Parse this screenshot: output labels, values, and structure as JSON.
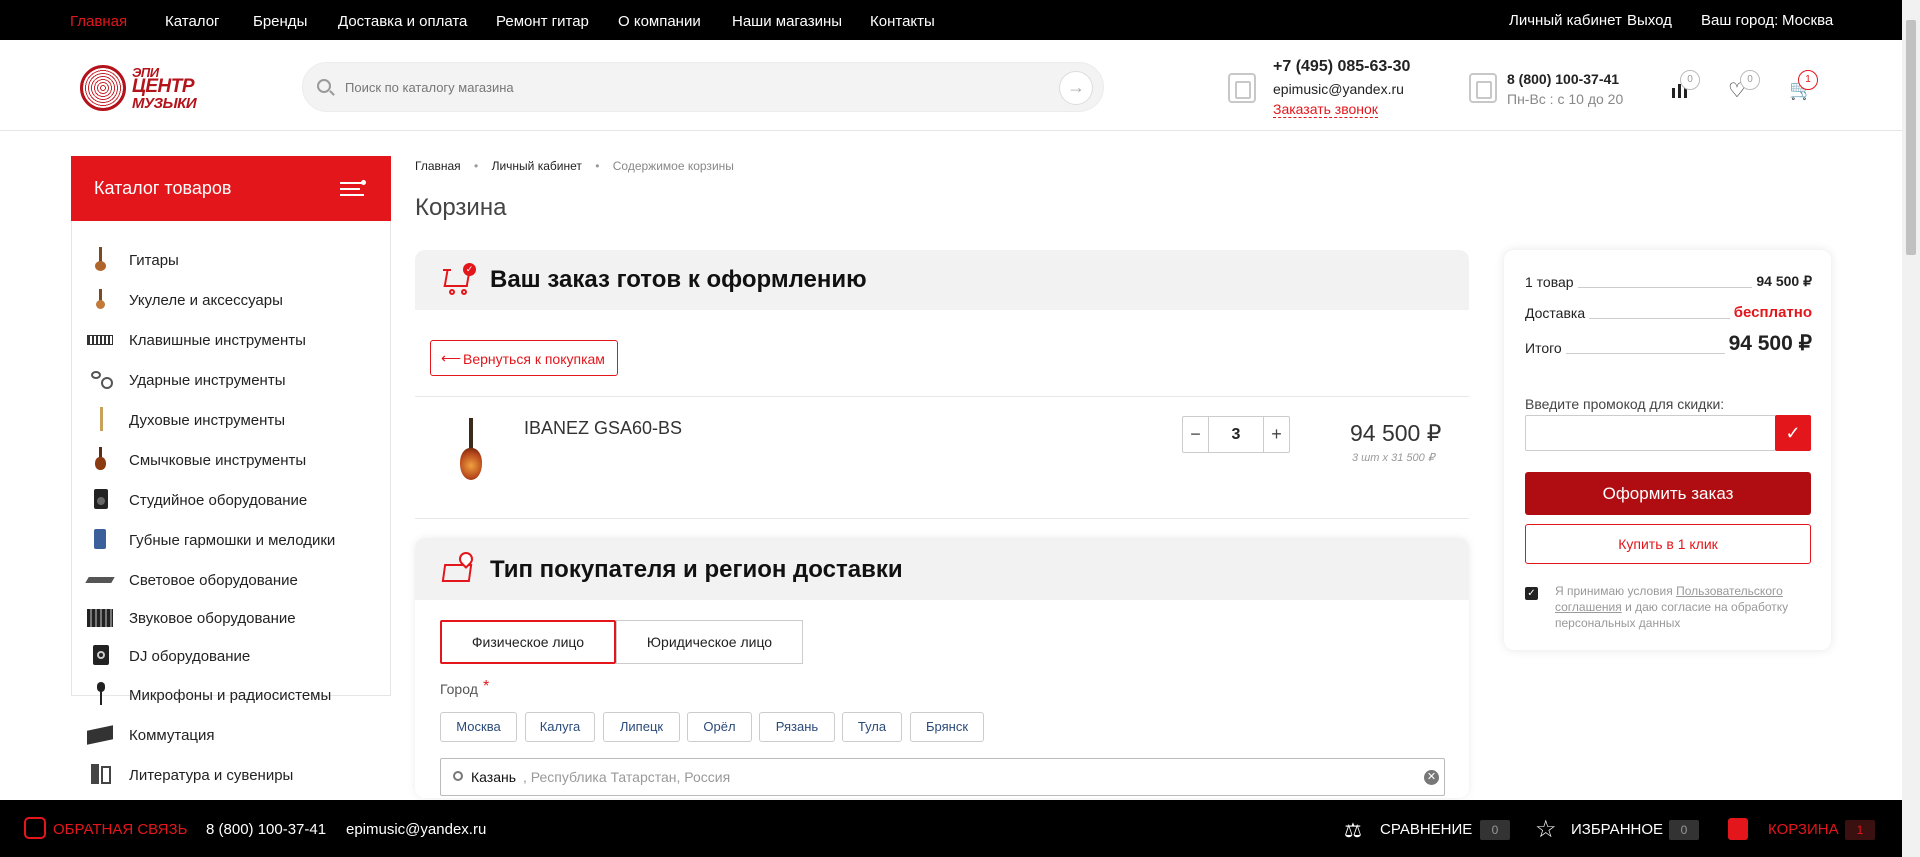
{
  "topnav": {
    "items": [
      "Главная",
      "Каталог",
      "Бренды",
      "Доставка и оплата",
      "Ремонт гитар",
      "О компании",
      "Наши магазины",
      "Контакты"
    ]
  },
  "topright": {
    "account": "Личный кабинет",
    "logout": "Выход",
    "city_label": "Ваш город:",
    "city": "Москва"
  },
  "logo": {
    "line1": "ЭПИ",
    "line2": "ЦЕНТР",
    "line3": "МУЗЫКИ"
  },
  "search": {
    "placeholder": "Поиск по каталогу магазина"
  },
  "contacts": {
    "phone1": "+7 (495) 085-63-30",
    "email": "epimusic@yandex.ru",
    "callback": "Заказать звонок",
    "phone2": "8 (800) 100-37-41",
    "hours": "Пн-Вс : с 10 до 20"
  },
  "header_counts": {
    "compare": "0",
    "favorites": "0",
    "cart": "1"
  },
  "catalog": {
    "title": "Каталог товаров",
    "items": [
      "Гитары",
      "Укулеле и аксессуары",
      "Клавишные инструменты",
      "Ударные инструменты",
      "Духовые инструменты",
      "Смычковые инструменты",
      "Студийное оборудование",
      "Губные гармошки и мелодики",
      "Световое оборудование",
      "Звуковое оборудование",
      "DJ оборудование",
      "Микрофоны и радиосистемы",
      "Коммутация",
      "Литература и сувениры"
    ]
  },
  "breadcrumb": [
    "Главная",
    "Личный кабинет",
    "Содержимое корзины"
  ],
  "page_title": "Корзина",
  "order_ready": {
    "title": "Ваш заказ готов к оформлению",
    "back": "Вернуться к покупкам"
  },
  "cart_item": {
    "name": "IBANEZ GSA60-BS",
    "qty": "3",
    "price": "94 500 ₽",
    "unit_note": "3 шт x 31 500 ₽",
    "minus": "−",
    "plus": "+"
  },
  "buyer": {
    "title": "Тип покупателя и регион доставки",
    "tabs": [
      "Физическое лицо",
      "Юридическое лицо"
    ],
    "city_label": "Город",
    "required_mark": "*",
    "cities": [
      "Москва",
      "Калуга",
      "Липецк",
      "Орёл",
      "Рязань",
      "Тула",
      "Брянск"
    ],
    "city_value": "Казань",
    "city_region": ", Республика Татарстан, Россия"
  },
  "summary": {
    "items_label": "1 товар",
    "items_value": "94 500 ₽",
    "delivery_label": "Доставка",
    "delivery_value": "бесплатно",
    "total_label": "Итого",
    "total_value": "94 500 ₽",
    "promo_label": "Введите промокод для скидки:",
    "order_btn": "Оформить заказ",
    "oneclick_btn": "Купить в 1 клик",
    "agree_pre": "Я принимаю условия ",
    "agree_link": "Пользовательского соглашения",
    "agree_post": " и даю согласие на обработку персональных данных"
  },
  "footer": {
    "feedback": "ОБРАТНАЯ СВЯЗЬ",
    "phone": "8 (800) 100-37-41",
    "email": "epimusic@yandex.ru",
    "compare": "СРАВНЕНИЕ",
    "compare_count": "0",
    "favorites": "ИЗБРАННОЕ",
    "favorites_count": "0",
    "cart": "КОРЗИНА",
    "cart_count": "1"
  },
  "colors": {
    "accent": "#e3161b",
    "dark_accent": "#b00d12"
  }
}
